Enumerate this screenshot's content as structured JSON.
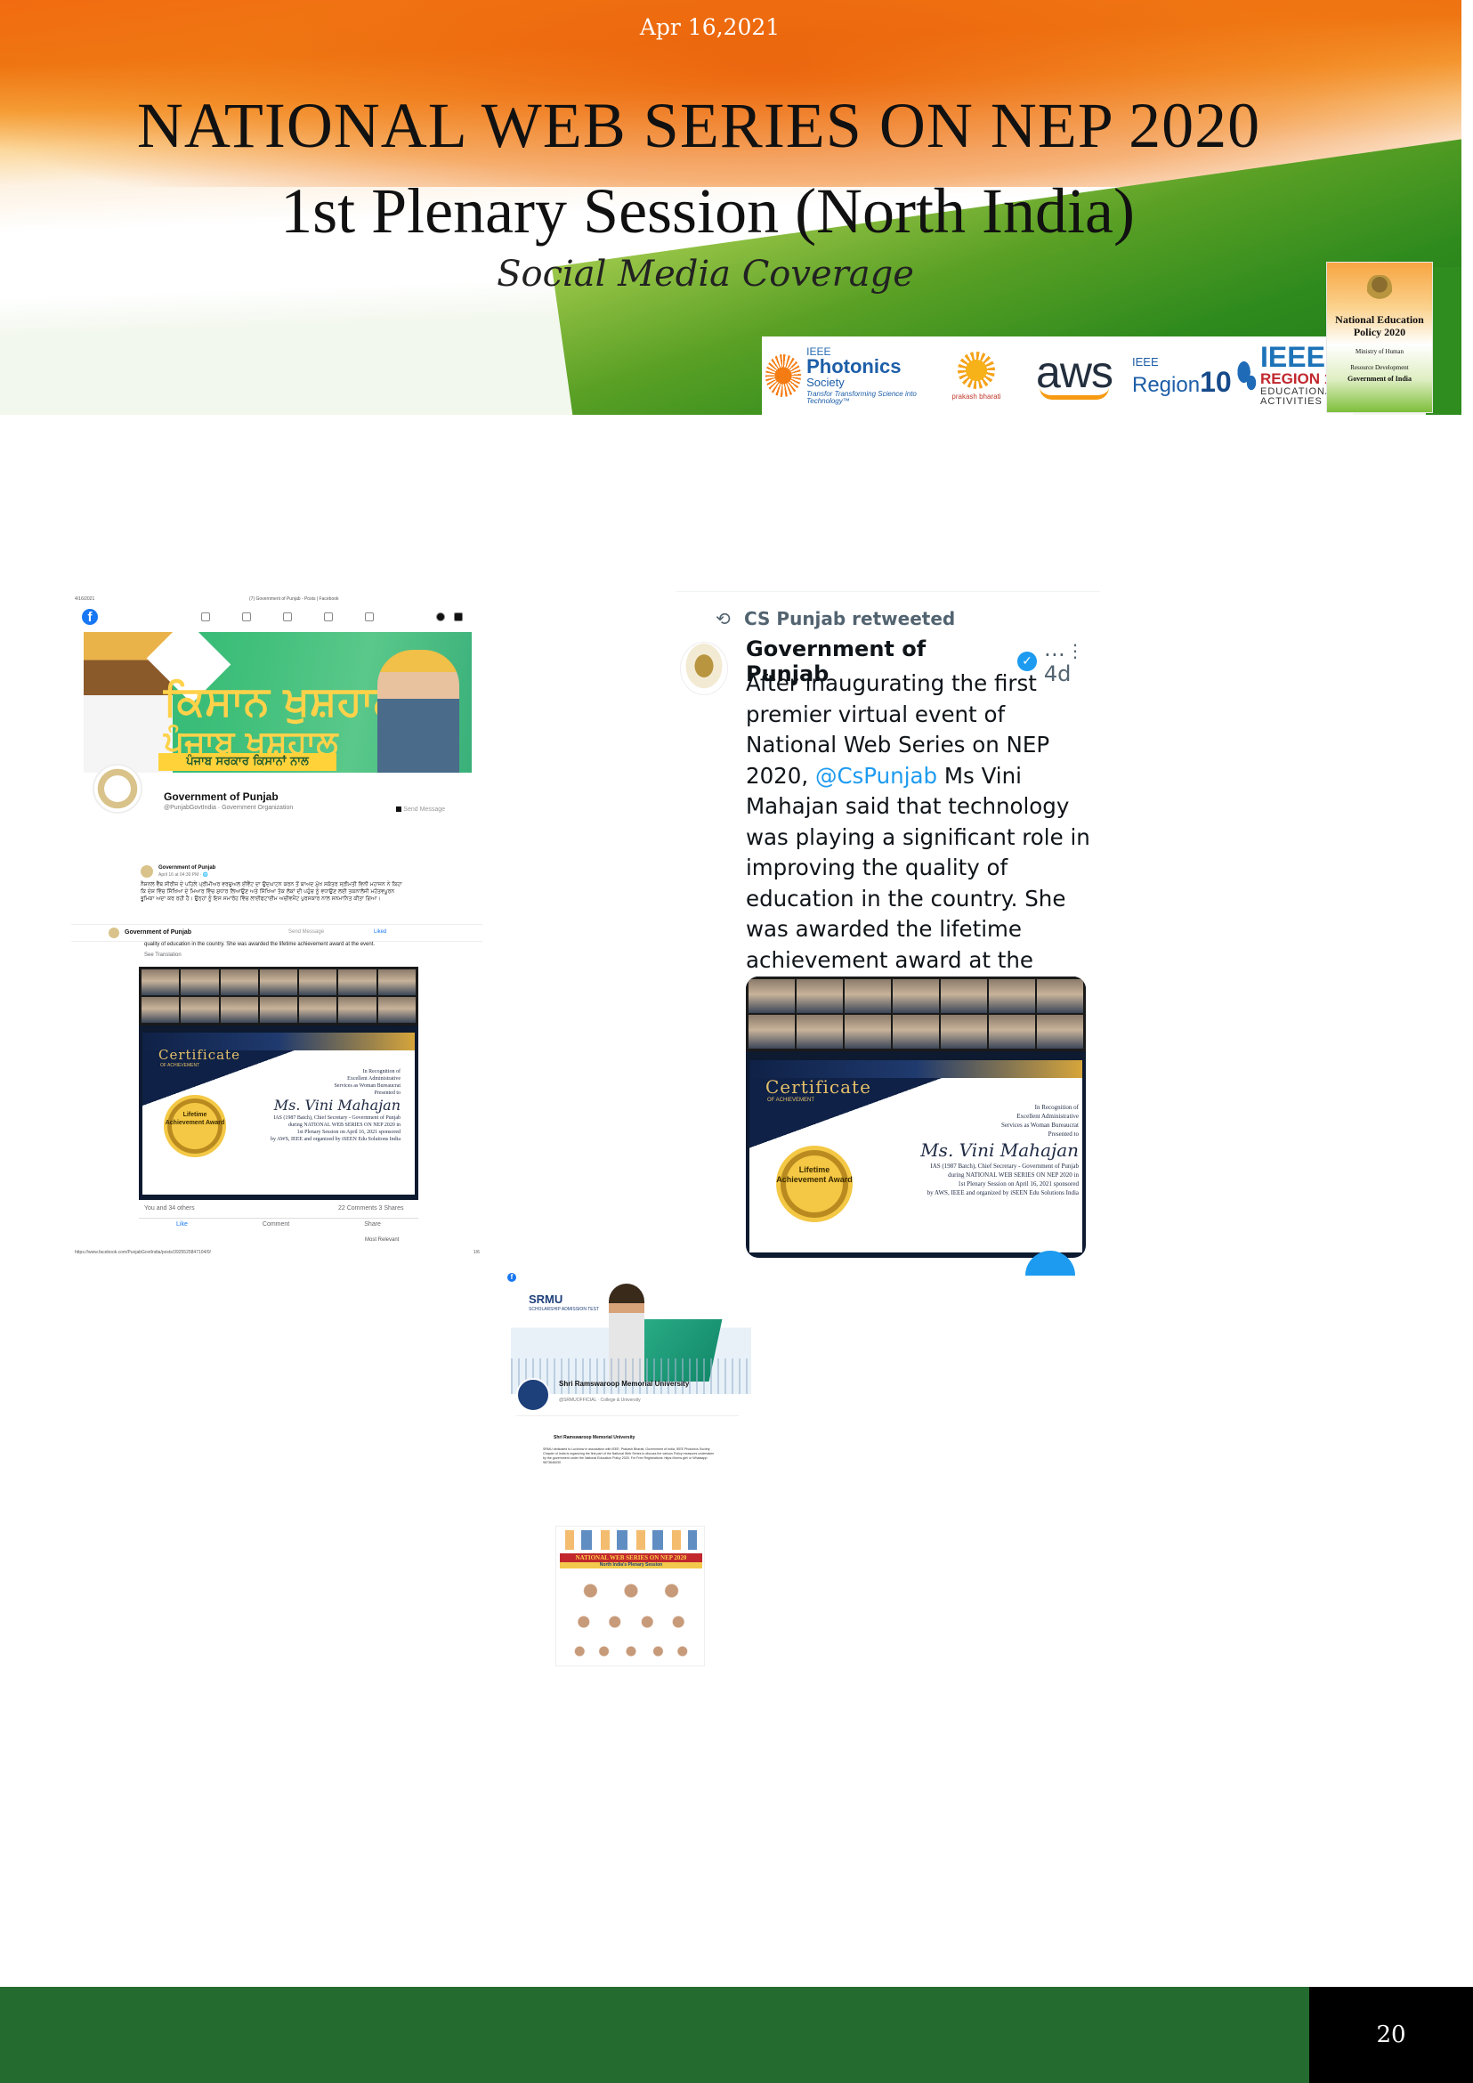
{
  "header": {
    "date": "Apr 16,2021",
    "title_line1": "NATIONAL WEB SERIES ON NEP 2020",
    "title_line2": "1st Plenary Session (North India)",
    "subtitle": "Social Media Coverage"
  },
  "sponsor_logos": {
    "photonics": {
      "ieee": "IEEE",
      "name": "Photonics",
      "society": "Society",
      "tagline": "Transfor Transforming Science into Technology™"
    },
    "prakash": {
      "name": "prakash bharati"
    },
    "aws": {
      "name": "aws"
    },
    "region10": {
      "ieee": "IEEE",
      "name": "Region",
      "number": "10"
    },
    "edu": {
      "ieee": "IEEE",
      "region": "REGION 10",
      "sub1": "EDUCATIONAL",
      "sub2": "ACTIVITIES"
    }
  },
  "nep_badge": {
    "title_line1": "National Education",
    "title_line2": "Policy 2020",
    "ministry_line1": "Ministry of Human",
    "ministry_line2": "Resource Development",
    "gov": "Government of India"
  },
  "facebook_post": {
    "browser_date": "4/16/2021",
    "browser_title": "(7) Government of Punjab - Posts | Facebook",
    "cover_text_1": "ਕਿਸਾਨ ਖੁਸ਼ਹਾਲ",
    "cover_text_2": "ਪੰਜਾਬ ਖੁਸ਼ਹਾਲ",
    "cover_band": "ਪੰਜਾਬ ਸਰਕਾਰ ਕਿਸਾਨਾਂ ਨਾਲ",
    "page_name": "Government of Punjab",
    "page_handle": "@PunjabGovtIndia · Government Organization",
    "send_message": "Send Message",
    "post_author": "Government of Punjab",
    "post_date": "April 16 at 04:30 PM · 🌐",
    "post_text": "ਨੈਸ਼ਨਲ ਵੈੱਬ ਸੀਰੀਜ਼ ਦੇ ਪਹਿਲੇ ਪ੍ਰੀਮੀਅਰ ਵਰਚੁਅਲ ਈਵੈਂਟ ਦਾ ਉਦਘਾਟਨ ਕਰਨ ਤੋਂ ਬਾਅਦ ਮੁੱਖ ਸਕੱਤਰ ਸ੍ਰੀਮਤੀ ਵਿਨੀ ਮਹਾਜਨ ਨੇ ਕਿਹਾ ਕਿ ਦੇਸ਼ ਵਿੱਚ ਸਿੱਖਿਆ ਦੇ ਮਿਆਰ ਵਿੱਚ ਸੁਧਾਰ ਲਿਆਉਣ ਅਤੇ ਸਿੱਖਿਆ ਤੱਕ ਲੋਕਾਂ ਦੀ ਪਹੁੰਚ ਨੂੰ ਵਧਾਉਣ ਲਈ ਤਕਨਾਲੋਜੀ ਮਹੱਤਵਪੂਰਨ ਭੂਮਿਕਾ ਅਦਾ ਕਰ ਰਹੀ ਹੈ। ਉਨ੍ਹਾਂ ਨੂੰ ਇਸ ਸਮਾਰੋਹ ਵਿੱਚ ਲਾਈਫਟਾਈਮ ਅਚੀਵਮੈਂਟ ਪੁਰਸਕਾਰ ਨਾਲ ਸਨਮਾਨਿਤ ਕੀਤਾ ਗਿਆ।",
    "strip_name": "Government of Punjab",
    "strip_send": "Send Message",
    "strip_liked": "Liked",
    "caption": "quality of education in the country. She was awarded the lifetime achievement award at the event.",
    "see_translation": "See Translation",
    "reactions": "You and 34 others",
    "counts": "22 Comments  3 Shares",
    "actions": [
      "Like",
      "Comment",
      "Share"
    ],
    "most_relevant": "Most Relevant",
    "footer_url": "https://www.facebook.com/PunjabGovtIndia/posts/3925525847104/0/",
    "footer_page": "1/6"
  },
  "certificate": {
    "title": "Certificate",
    "of": "OF ACHIEVEMENT",
    "recognition": "In Recognition of",
    "service": "Excellent Administrative",
    "service2": "Services as Woman Bureaucrat",
    "presented": "Presented to",
    "name": "Ms. Vini Mahajan",
    "role": "IAS (1987 Batch), Chief Secretary - Government of Punjab",
    "event1": "during NATIONAL WEB SERIES ON NEP 2020 in",
    "event2": "1st Plenary Session on April 16, 2021 sponsored",
    "event3": "by AWS, IEEE and organized by iSEEN Edu Solutions India",
    "medal": "Lifetime Achievement Award"
  },
  "tweet": {
    "retweeted_by": "CS Punjab retweeted",
    "author": "Government of Punjab",
    "verified_mark": "✓",
    "time": "… 4d",
    "more": "⋮",
    "text_before": "After inaugurating the first premier virtual event of National Web Series on NEP 2020, ",
    "mention": "@CsPunjab",
    "text_after": " Ms Vini Mahajan said that technology was playing a significant role in improving the quality of education in the country. She was awarded the lifetime achievement award at the event."
  },
  "srmu_post": {
    "logo": "SRMU",
    "logo_sub": "SCHOLARSHIP ADMISSION TEST",
    "page_name": "Shri Ramswaroop Memorial University",
    "category": "@SRMUOFFICIAL · College & University",
    "post_author": "Shri Ramswaroop Memorial University",
    "post_text": "SRMU dedicated to Lucknow in association with IEEE, Prakash Bharati, Government of India, IEEE Photonics Society Chapter of India is organizing the first part of the National Web Series to discuss the various Policy measures undertaken by the government under the National Education Policy 2020. For Free Registrations: https://forms.gle/ or Whatsapp: 9873646030",
    "poster_title": "NATIONAL WEB SERIES ON NEP 2020",
    "poster_sub": "North India's Plenary Session"
  },
  "footer": {
    "page_number": "20"
  }
}
